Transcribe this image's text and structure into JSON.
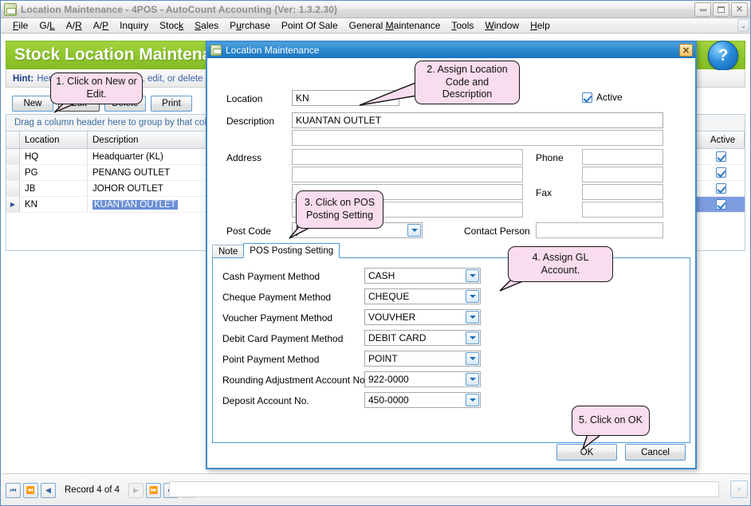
{
  "window": {
    "title": "Location Maintenance - 4POS - AutoCount Accounting (Ver: 1.3.2.30)",
    "icon": "app-icon",
    "minimize": "–",
    "maximize": "□",
    "close": "✕"
  },
  "menubar": {
    "items": [
      {
        "label": "File"
      },
      {
        "label": "G/L"
      },
      {
        "label": "A/R"
      },
      {
        "label": "A/P"
      },
      {
        "label": "Inquiry"
      },
      {
        "label": "Stock"
      },
      {
        "label": "Sales"
      },
      {
        "label": "Purchase"
      },
      {
        "label": "Point Of Sale"
      },
      {
        "label": "General Maintenance"
      },
      {
        "label": "Tools"
      },
      {
        "label": "Window"
      },
      {
        "label": "Help"
      }
    ],
    "overflow": "⌄"
  },
  "page": {
    "title": "Stock Location Maintenance",
    "help_glyph": "?",
    "hint_label": "Hint:",
    "hint_text": "Here you can view, create, edit, or delete Stock Location. You can assign default POS posting information too.",
    "toolbar": [
      {
        "label": "New"
      },
      {
        "label": "Edit"
      },
      {
        "label": "Delete"
      },
      {
        "label": "Print"
      }
    ],
    "group_panel": "Drag a column header here to group by that column",
    "grid": {
      "columns": [
        "Location",
        "Description",
        "Active"
      ],
      "rows": [
        {
          "indicator": "",
          "location": "HQ",
          "description": "Headquarter (KL)",
          "active": true,
          "selected": false
        },
        {
          "indicator": "",
          "location": "PG",
          "description": "PENANG OUTLET",
          "active": true,
          "selected": false
        },
        {
          "indicator": "",
          "location": "JB",
          "description": "JOHOR OUTLET",
          "active": true,
          "selected": false
        },
        {
          "indicator": "▶",
          "location": "KN",
          "description": "KUANTAN OUTLET",
          "active": true,
          "selected": true
        }
      ]
    },
    "status": {
      "first": "⏮",
      "prev_page": "⏪",
      "prev": "◀",
      "record_text": "Record 4 of 4",
      "next": "▶",
      "next_page": "⏩",
      "last": "⏭",
      "extra": "‹",
      "right_scroll": "›"
    }
  },
  "dialog": {
    "title": "Location Maintenance",
    "close": "✕",
    "fields": {
      "location_label": "Location",
      "location_value": "KN",
      "description_label": "Description",
      "description_value": "KUANTAN OUTLET",
      "description_line2": "",
      "address_label": "Address",
      "address_line1": "",
      "address_line2": "",
      "address_line3": "",
      "address_line4": "",
      "phone_label": "Phone",
      "phone_1": "",
      "phone_2": "",
      "fax_label": "Fax",
      "fax_1": "",
      "fax_2": "",
      "post_code_label": "Post Code",
      "post_code_value": "",
      "contact_person_label": "Contact Person",
      "contact_person_value": "",
      "active_label": "Active",
      "active_checked": true
    },
    "tabs": [
      {
        "label": "Note",
        "active": false
      },
      {
        "label": "POS Posting Setting",
        "active": true
      }
    ],
    "pos_posting": [
      {
        "label": "Cash Payment Method",
        "value": "CASH"
      },
      {
        "label": "Cheque Payment Method",
        "value": "CHEQUE"
      },
      {
        "label": "Voucher Payment Method",
        "value": "VOUVHER"
      },
      {
        "label": "Debit Card Payment Method",
        "value": "DEBIT CARD"
      },
      {
        "label": "Point Payment Method",
        "value": "POINT"
      },
      {
        "label": "Rounding Adjustment Account No",
        "value": "922-0000"
      },
      {
        "label": "Deposit Account No.",
        "value": "450-0000"
      }
    ],
    "buttons": {
      "ok": "OK",
      "cancel": "Cancel"
    }
  },
  "callouts": [
    {
      "id": "callout-1",
      "text": "1. Click on New or Edit."
    },
    {
      "id": "callout-2",
      "text": "2. Assign Location Code and Description"
    },
    {
      "id": "callout-3",
      "text": "3. Click on POS Posting Setting"
    },
    {
      "id": "callout-4",
      "text": "4. Assign GL Account."
    },
    {
      "id": "callout-5",
      "text": "5. Click on OK"
    }
  ],
  "colors": {
    "green_header": "#8fc62c",
    "dialog_title": "#2a86cd",
    "callout_bg": "#f9dced",
    "selection": "#7e9ce0",
    "accent_blue": "#5b9bd5"
  }
}
